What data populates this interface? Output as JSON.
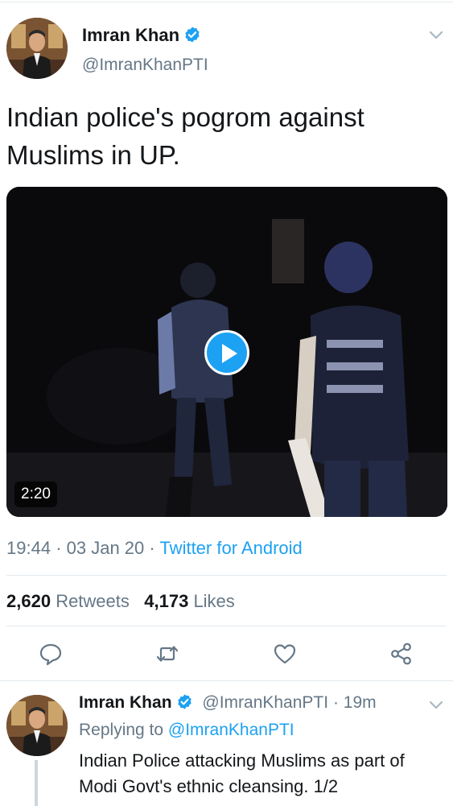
{
  "main_tweet": {
    "author_name": "Imran Khan",
    "author_handle": "@ImranKhanPTI",
    "text": "Indian police's pogrom against Muslims in UP.",
    "video": {
      "duration": "2:20"
    },
    "time": "19:44",
    "date": "03 Jan 20",
    "separator": "·",
    "source": "Twitter for Android",
    "retweets_count": "2,620",
    "retweets_label": "Retweets",
    "likes_count": "4,173",
    "likes_label": "Likes"
  },
  "reply_tweet": {
    "author_name": "Imran Khan",
    "author_handle": "@ImranKhanPTI",
    "age": "19m",
    "separator": "·",
    "replying_prefix": "Replying to",
    "replying_to": "@ImranKhanPTI",
    "text": "Indian Police attacking Muslims as part of Modi Govt's ethnic cleansing. 1/2"
  },
  "icons": {
    "actions": [
      "reply-icon",
      "retweet-icon",
      "like-icon",
      "share-icon"
    ],
    "verified": "verified-badge-icon",
    "menu": "chevron-down-icon"
  },
  "colors": {
    "accent": "#1da1f2",
    "secondary_text": "#657786",
    "primary_text": "#14171a",
    "divider": "#e1e8ed"
  }
}
